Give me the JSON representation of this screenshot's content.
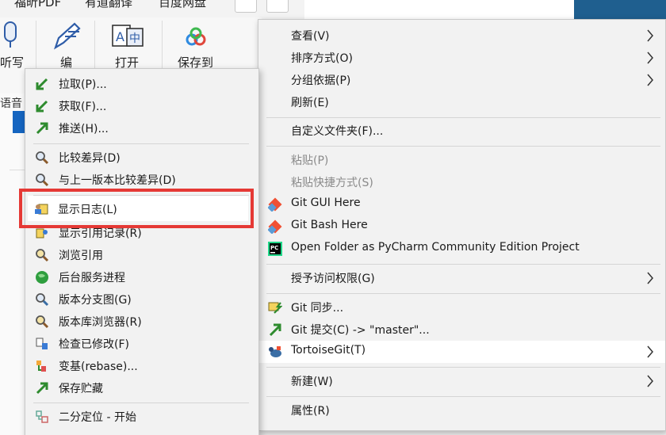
{
  "background": {
    "top_tabs": [
      "福昕PDF",
      "有道翻译",
      "百度网盘"
    ],
    "ribbon": [
      "听写",
      "编",
      "打开",
      "保存到"
    ],
    "side_label": "语音"
  },
  "left_menu": {
    "items": [
      {
        "label": "拉取(P)...",
        "icon": "git-pull-icon"
      },
      {
        "label": "获取(F)...",
        "icon": "git-fetch-icon"
      },
      {
        "label": "推送(H)...",
        "icon": "git-push-icon"
      },
      {
        "label": "比较差异(D)",
        "icon": "diff-magnifier-icon"
      },
      {
        "label": "与上一版本比较差异(D)",
        "icon": "diff-previous-icon"
      },
      {
        "label": "显示日志(L)",
        "icon": "show-log-icon"
      },
      {
        "label": "显示引用记录(R)",
        "icon": "reflog-icon"
      },
      {
        "label": "浏览引用",
        "icon": "browse-refs-icon"
      },
      {
        "label": "后台服务进程",
        "icon": "daemon-globe-icon"
      },
      {
        "label": "版本分支图(G)",
        "icon": "revision-graph-icon"
      },
      {
        "label": "版本库浏览器(R)",
        "icon": "repo-browser-icon"
      },
      {
        "label": "检查已修改(F)",
        "icon": "check-modifications-icon"
      },
      {
        "label": "变基(rebase)...",
        "icon": "rebase-icon"
      },
      {
        "label": "保存贮藏",
        "icon": "stash-save-icon"
      },
      {
        "label": "二分定位 - 开始",
        "icon": "bisect-icon"
      }
    ],
    "highlighted": "显示日志(L)"
  },
  "right_menu": {
    "items": [
      {
        "label": "查看(V)",
        "submenu": true
      },
      {
        "label": "排序方式(O)",
        "submenu": true
      },
      {
        "label": "分组依据(P)",
        "submenu": true
      },
      {
        "label": "刷新(E)",
        "submenu": false
      },
      {
        "label": "自定义文件夹(F)...",
        "submenu": false
      },
      {
        "label": "粘贴(P)",
        "disabled": true
      },
      {
        "label": "粘贴快捷方式(S)",
        "disabled": true
      },
      {
        "label": "Git GUI Here",
        "icon": "git-gui-icon"
      },
      {
        "label": "Git Bash Here",
        "icon": "git-bash-icon"
      },
      {
        "label": "Open Folder as PyCharm Community Edition Project",
        "icon": "pycharm-icon"
      },
      {
        "label": "授予访问权限(G)",
        "submenu": true
      },
      {
        "label": "Git 同步...",
        "icon": "git-sync-icon"
      },
      {
        "label": "Git 提交(C) -> \"master\"...",
        "icon": "git-commit-icon"
      },
      {
        "label": "TortoiseGit(T)",
        "icon": "tortoisegit-icon",
        "submenu": true,
        "highlighted": true
      },
      {
        "label": "新建(W)",
        "submenu": true
      },
      {
        "label": "属性(R)",
        "submenu": false
      }
    ]
  },
  "colors": {
    "highlight_box": "#e53935",
    "menu_bg": "#f2f2f2",
    "accent_blue": "#1565c0"
  }
}
